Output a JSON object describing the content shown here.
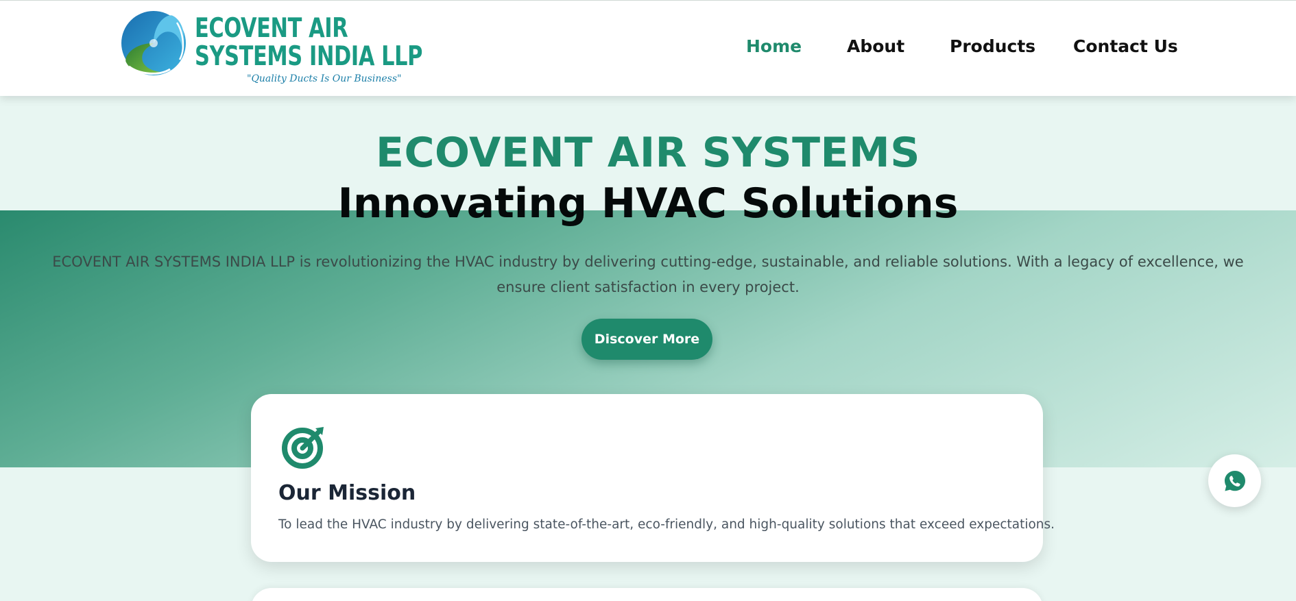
{
  "brand": {
    "name_line1": "ECOVENT AIR",
    "name_line2": "SYSTEMS INDIA LLP",
    "tagline": "\"Quality Ducts Is Our Business\"",
    "colors": {
      "primary": "#1f8a6c",
      "logo_text": "#1a9a83",
      "tagline": "#1c7fa8"
    }
  },
  "nav": {
    "items": [
      {
        "label": "Home",
        "active": true
      },
      {
        "label": "About",
        "active": false
      },
      {
        "label": "Products",
        "active": false
      },
      {
        "label": "Contact Us",
        "active": false
      }
    ]
  },
  "hero": {
    "title": "ECOVENT AIR SYSTEMS",
    "subtitle": "Innovating HVAC Solutions",
    "description": "ECOVENT AIR SYSTEMS INDIA LLP is revolutionizing the HVAC industry by delivering cutting-edge, sustainable, and reliable solutions. With a legacy of excellence, we ensure client satisfaction in every project.",
    "cta_label": "Discover More"
  },
  "mission": {
    "icon": "target-icon",
    "title": "Our Mission",
    "text": "To lead the HVAC industry by delivering state-of-the-art, eco-friendly, and high-quality solutions that exceed expectations."
  },
  "floating": {
    "icon": "whatsapp-icon"
  }
}
